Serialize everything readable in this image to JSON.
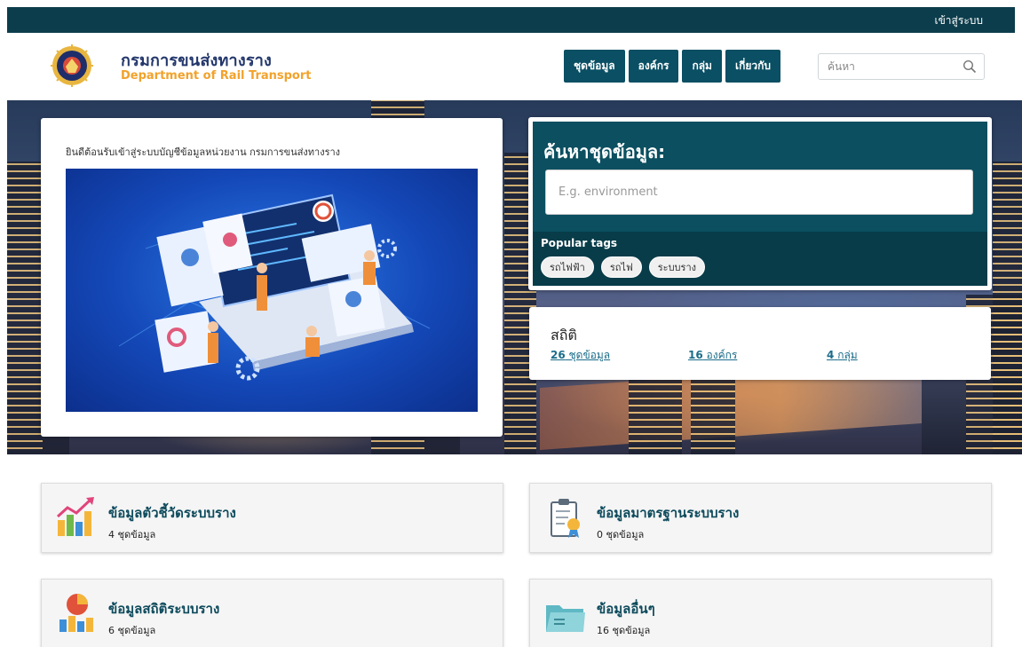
{
  "topbar": {
    "login": "เข้าสู่ระบบ"
  },
  "header": {
    "logo_th": "กรมการขนส่งทางราง",
    "logo_en": "Department of Rail Transport"
  },
  "nav": {
    "items": [
      {
        "label": "ชุดข้อมูล"
      },
      {
        "label": "องค์กร"
      },
      {
        "label": "กลุ่ม"
      },
      {
        "label": "เกี่ยวกับ"
      }
    ],
    "search_placeholder": "ค้นหา"
  },
  "welcome": {
    "text": "ยินดีต้อนรับเข้าสู่ระบบบัญชีข้อมูลหน่วยงาน กรมการขนส่งทางราง"
  },
  "dataset_search": {
    "title": "ค้นหาชุดข้อมูล:",
    "placeholder": "E.g. environment",
    "popular_tags_title": "Popular tags",
    "tags": [
      "รถไฟฟ้า",
      "รถไฟ",
      "ระบบราง"
    ]
  },
  "stats": {
    "title": "สถิติ",
    "datasets_count": "26",
    "datasets_label": "ชุดข้อมูล",
    "orgs_count": "16",
    "orgs_label": "องค์กร",
    "groups_count": "4",
    "groups_label": "กลุ่ม"
  },
  "categories": [
    {
      "name": "ข้อมูลตัวชี้วัดระบบราง",
      "count": "4 ชุดข้อมูล",
      "icon": "chart-growth-icon"
    },
    {
      "name": "ข้อมูลมาตรฐานระบบราง",
      "count": "0 ชุดข้อมูล",
      "icon": "clipboard-award-icon"
    },
    {
      "name": "ข้อมูลสถิติระบบราง",
      "count": "6 ชุดข้อมูล",
      "icon": "pie-bar-chart-icon"
    },
    {
      "name": "ข้อมูลอื่นๆ",
      "count": "16 ชุดข้อมูล",
      "icon": "folder-icon"
    }
  ],
  "colors": {
    "primary_dark": "#0c3d4c",
    "nav_button": "#0a4f63",
    "logo_navy": "#23376c",
    "logo_orange": "#f2a22b",
    "link": "#1a6d8a"
  }
}
